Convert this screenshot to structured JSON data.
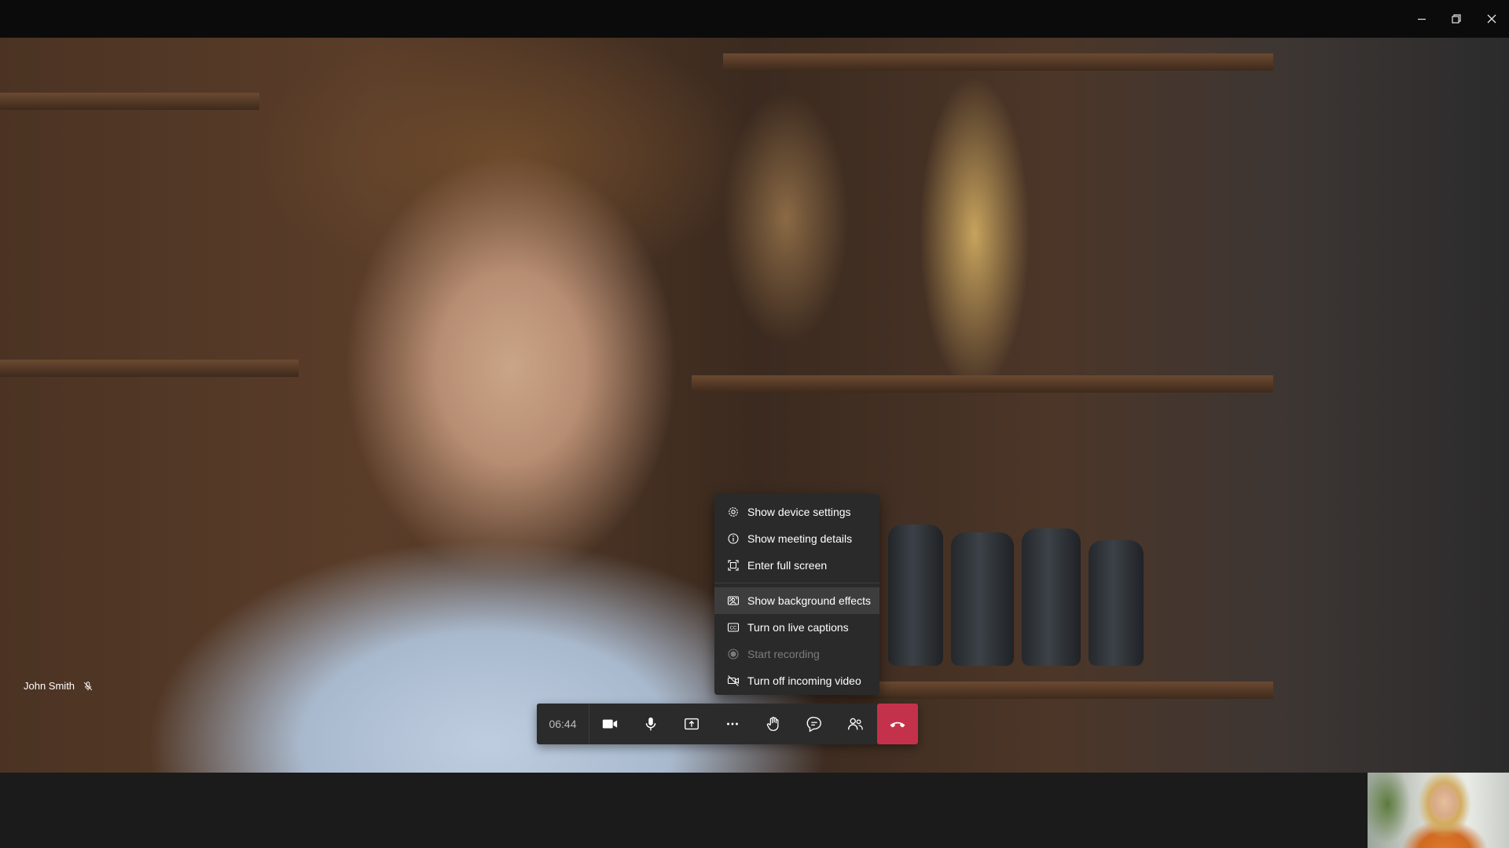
{
  "window": {
    "controls": [
      "minimize-icon",
      "restore-icon",
      "close-icon"
    ]
  },
  "participant": {
    "name": "John Smith",
    "mic_icon": "mic-off-icon"
  },
  "menu": {
    "items": [
      {
        "label": "Show device settings",
        "icon": "gear-icon"
      },
      {
        "label": "Show meeting details",
        "icon": "info-icon"
      },
      {
        "label": "Enter full screen",
        "icon": "fullscreen-icon"
      },
      {
        "label": "Show background effects",
        "icon": "background-effects-icon",
        "highlighted": true
      },
      {
        "label": "Turn on live captions",
        "icon": "captions-icon"
      },
      {
        "label": "Start recording",
        "icon": "record-icon",
        "disabled": true
      },
      {
        "label": "Turn off incoming video",
        "icon": "video-off-icon"
      }
    ]
  },
  "toolbar": {
    "timer": "06:44",
    "buttons": [
      "camera-icon",
      "microphone-icon",
      "share-screen-icon",
      "more-options-icon",
      "raise-hand-icon",
      "chat-icon",
      "participants-icon",
      "hang-up-icon"
    ]
  },
  "colors": {
    "hangup": "#c4314b",
    "toolbar_bg": "#2b2b2b",
    "menu_bg": "#2a2a2a"
  }
}
